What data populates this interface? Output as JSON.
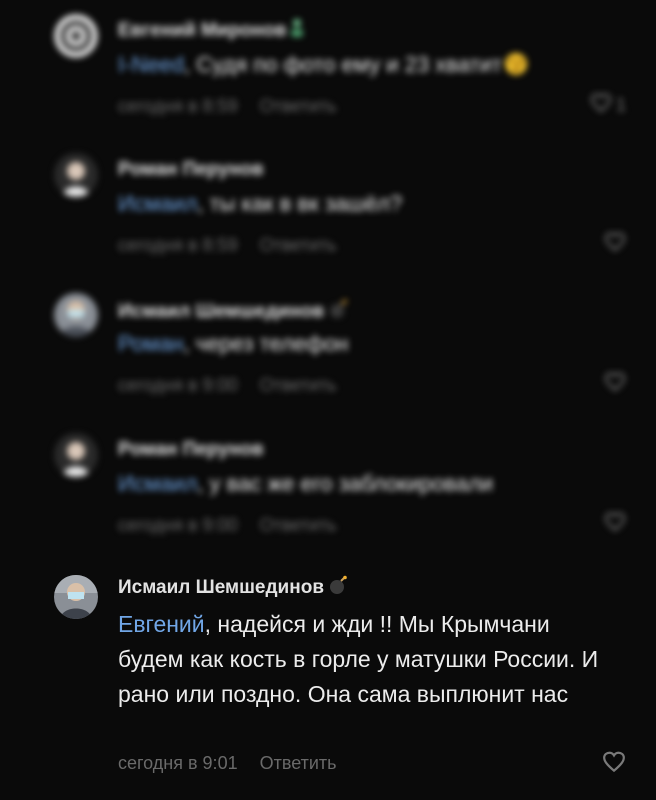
{
  "comments": [
    {
      "author": "Евгений Миронов",
      "mention": "I-Need",
      "text": ", Судя по фото ему и 23 хватит",
      "time": "сегодня в 8:59",
      "reply": "Ответить",
      "likes": "1",
      "badge_icon": "person-badge-icon",
      "inline_emoji": "dizzy-face-emoji"
    },
    {
      "author": "Роман Перунов",
      "mention": "Исмаил",
      "text": ", ты как в вк зашёл?",
      "time": "сегодня в 8:59",
      "reply": "Ответить"
    },
    {
      "author": "Исмаил Шемшединов",
      "mention": "Роман",
      "text": ", через телефон",
      "time": "сегодня в 9:00",
      "reply": "Ответить",
      "badge_icon": "bomb-icon"
    },
    {
      "author": "Роман Перунов",
      "mention": "Исмаил",
      "text": ", у вас же его заблокировали",
      "time": "сегодня в 9:00",
      "reply": "Ответить"
    },
    {
      "author": "Исмаил Шемшединов",
      "mention": "Евгений",
      "text": ", надейся и жди !! Мы Крымчани будем как кость в горле у матушки России.  И рано или поздно. Она сама выплюнит нас",
      "time": "сегодня в 9:01",
      "reply": "Ответить",
      "badge_icon": "bomb-icon"
    }
  ],
  "colors": {
    "background": "#0a0a0a",
    "mention": "#71a6e6",
    "meta": "#6a6a6a",
    "text": "#ececec"
  }
}
